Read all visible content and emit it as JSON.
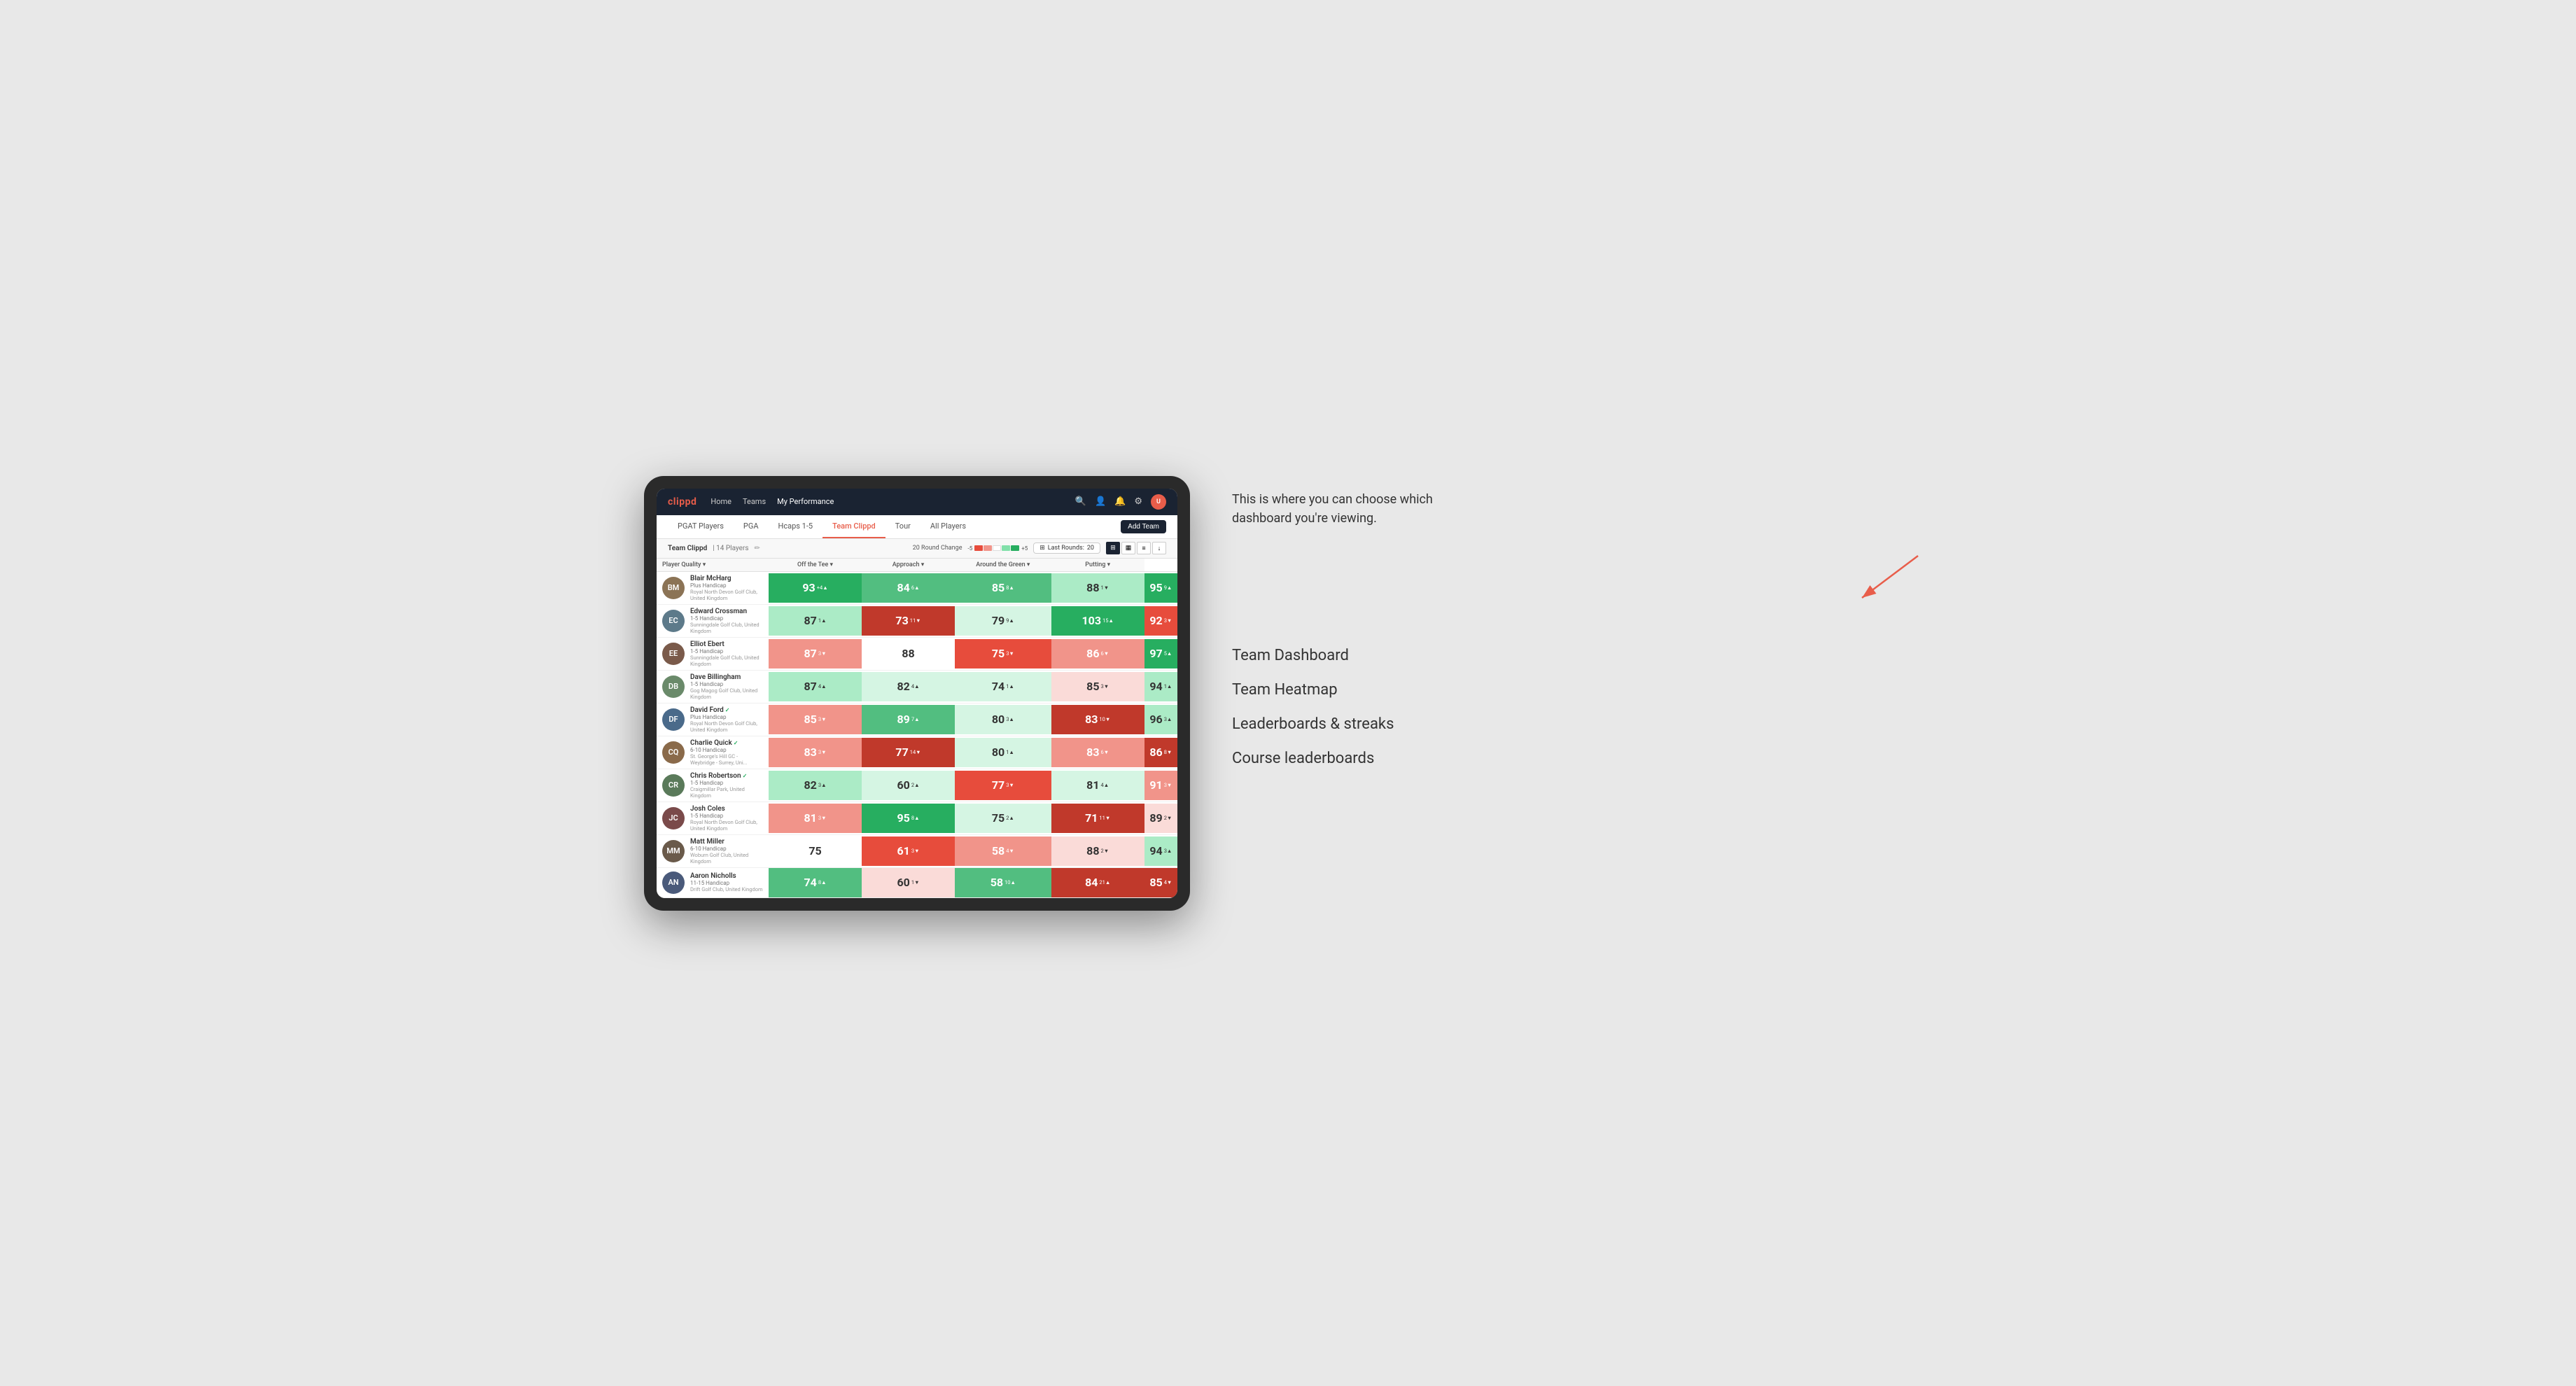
{
  "annotation": {
    "text": "This is where you can choose which dashboard you're viewing.",
    "menu_items": [
      "Team Dashboard",
      "Team Heatmap",
      "Leaderboards & streaks",
      "Course leaderboards"
    ]
  },
  "nav": {
    "logo": "clippd",
    "links": [
      "Home",
      "Teams",
      "My Performance"
    ],
    "active_link": "My Performance"
  },
  "sub_nav": {
    "links": [
      "PGAT Players",
      "PGA",
      "Hcaps 1-5",
      "Team Clippd",
      "Tour",
      "All Players"
    ],
    "active_link": "Team Clippd",
    "add_team_label": "Add Team"
  },
  "team_header": {
    "name": "Team Clippd",
    "separator": "|",
    "players_count": "14 Players",
    "round_change_label": "20 Round Change",
    "scale_minus": "-5",
    "scale_plus": "+5",
    "last_rounds_label": "Last Rounds:",
    "last_rounds_value": "20"
  },
  "table": {
    "columns": {
      "player": "Player Quality ▾",
      "off_tee": "Off the Tee ▾",
      "approach": "Approach ▾",
      "around_green": "Around the Green ▾",
      "putting": "Putting ▾"
    },
    "rows": [
      {
        "name": "Blair McHarg",
        "handicap": "Plus Handicap",
        "club": "Royal North Devon Golf Club, United Kingdom",
        "avatar_color": "#8B7355",
        "initials": "BM",
        "quality": {
          "value": 93,
          "change": "+4",
          "dir": "up",
          "bg": "bg-dark-green"
        },
        "off_tee": {
          "value": 84,
          "change": "6",
          "dir": "up",
          "bg": "bg-med-green"
        },
        "approach": {
          "value": 85,
          "change": "8",
          "dir": "up",
          "bg": "bg-med-green"
        },
        "around_green": {
          "value": 88,
          "change": "1",
          "dir": "down",
          "bg": "bg-light-green"
        },
        "putting": {
          "value": 95,
          "change": "9",
          "dir": "up",
          "bg": "bg-dark-green"
        }
      },
      {
        "name": "Edward Crossman",
        "handicap": "1-5 Handicap",
        "club": "Sunningdale Golf Club, United Kingdom",
        "avatar_color": "#5d7a8a",
        "initials": "EC",
        "quality": {
          "value": 87,
          "change": "1",
          "dir": "up",
          "bg": "bg-light-green"
        },
        "off_tee": {
          "value": 73,
          "change": "11",
          "dir": "down",
          "bg": "bg-dark-red"
        },
        "approach": {
          "value": 79,
          "change": "9",
          "dir": "up",
          "bg": "bg-pale-green"
        },
        "around_green": {
          "value": 103,
          "change": "15",
          "dir": "up",
          "bg": "bg-dark-green"
        },
        "putting": {
          "value": 92,
          "change": "3",
          "dir": "down",
          "bg": "bg-med-red"
        }
      },
      {
        "name": "Elliot Ebert",
        "handicap": "1-5 Handicap",
        "club": "Sunningdale Golf Club, United Kingdom",
        "avatar_color": "#7a5a4a",
        "initials": "EE",
        "quality": {
          "value": 87,
          "change": "3",
          "dir": "down",
          "bg": "bg-light-red"
        },
        "off_tee": {
          "value": 88,
          "change": "",
          "dir": "",
          "bg": "bg-white"
        },
        "approach": {
          "value": 75,
          "change": "3",
          "dir": "down",
          "bg": "bg-med-red"
        },
        "around_green": {
          "value": 86,
          "change": "6",
          "dir": "down",
          "bg": "bg-light-red"
        },
        "putting": {
          "value": 97,
          "change": "5",
          "dir": "up",
          "bg": "bg-dark-green"
        }
      },
      {
        "name": "Dave Billingham",
        "handicap": "1-5 Handicap",
        "club": "Gog Magog Golf Club, United Kingdom",
        "avatar_color": "#6a8a6a",
        "initials": "DB",
        "quality": {
          "value": 87,
          "change": "4",
          "dir": "up",
          "bg": "bg-light-green"
        },
        "off_tee": {
          "value": 82,
          "change": "4",
          "dir": "up",
          "bg": "bg-pale-green"
        },
        "approach": {
          "value": 74,
          "change": "1",
          "dir": "up",
          "bg": "bg-pale-green"
        },
        "around_green": {
          "value": 85,
          "change": "3",
          "dir": "down",
          "bg": "bg-pale-red"
        },
        "putting": {
          "value": 94,
          "change": "1",
          "dir": "up",
          "bg": "bg-light-green"
        }
      },
      {
        "name": "David Ford",
        "handicap": "Plus Handicap",
        "club": "Royal North Devon Golf Club, United Kingdom",
        "avatar_color": "#4a6a8a",
        "initials": "DF",
        "verified": true,
        "quality": {
          "value": 85,
          "change": "3",
          "dir": "down",
          "bg": "bg-light-red"
        },
        "off_tee": {
          "value": 89,
          "change": "7",
          "dir": "up",
          "bg": "bg-med-green"
        },
        "approach": {
          "value": 80,
          "change": "3",
          "dir": "up",
          "bg": "bg-pale-green"
        },
        "around_green": {
          "value": 83,
          "change": "10",
          "dir": "down",
          "bg": "bg-dark-red"
        },
        "putting": {
          "value": 96,
          "change": "3",
          "dir": "up",
          "bg": "bg-light-green"
        }
      },
      {
        "name": "Charlie Quick",
        "handicap": "6-10 Handicap",
        "club": "St. George's Hill GC - Weybridge - Surrey, Uni...",
        "avatar_color": "#8a6a4a",
        "initials": "CQ",
        "verified": true,
        "quality": {
          "value": 83,
          "change": "3",
          "dir": "down",
          "bg": "bg-light-red"
        },
        "off_tee": {
          "value": 77,
          "change": "14",
          "dir": "down",
          "bg": "bg-dark-red"
        },
        "approach": {
          "value": 80,
          "change": "1",
          "dir": "up",
          "bg": "bg-pale-green"
        },
        "around_green": {
          "value": 83,
          "change": "6",
          "dir": "down",
          "bg": "bg-light-red"
        },
        "putting": {
          "value": 86,
          "change": "8",
          "dir": "down",
          "bg": "bg-dark-red"
        }
      },
      {
        "name": "Chris Robertson",
        "handicap": "1-5 Handicap",
        "club": "Craigmillar Park, United Kingdom",
        "avatar_color": "#5a7a5a",
        "initials": "CR",
        "verified": true,
        "quality": {
          "value": 82,
          "change": "3",
          "dir": "up",
          "bg": "bg-light-green"
        },
        "off_tee": {
          "value": 60,
          "change": "2",
          "dir": "up",
          "bg": "bg-pale-green"
        },
        "approach": {
          "value": 77,
          "change": "3",
          "dir": "down",
          "bg": "bg-med-red"
        },
        "around_green": {
          "value": 81,
          "change": "4",
          "dir": "up",
          "bg": "bg-pale-green"
        },
        "putting": {
          "value": 91,
          "change": "3",
          "dir": "down",
          "bg": "bg-light-red"
        }
      },
      {
        "name": "Josh Coles",
        "handicap": "1-5 Handicap",
        "club": "Royal North Devon Golf Club, United Kingdom",
        "avatar_color": "#7a4a4a",
        "initials": "JC",
        "quality": {
          "value": 81,
          "change": "3",
          "dir": "down",
          "bg": "bg-light-red"
        },
        "off_tee": {
          "value": 95,
          "change": "8",
          "dir": "up",
          "bg": "bg-dark-green"
        },
        "approach": {
          "value": 75,
          "change": "2",
          "dir": "up",
          "bg": "bg-pale-green"
        },
        "around_green": {
          "value": 71,
          "change": "11",
          "dir": "down",
          "bg": "bg-dark-red"
        },
        "putting": {
          "value": 89,
          "change": "2",
          "dir": "down",
          "bg": "bg-pale-red"
        }
      },
      {
        "name": "Matt Miller",
        "handicap": "6-10 Handicap",
        "club": "Woburn Golf Club, United Kingdom",
        "avatar_color": "#6a5a4a",
        "initials": "MM",
        "quality": {
          "value": 75,
          "change": "",
          "dir": "",
          "bg": "bg-white"
        },
        "off_tee": {
          "value": 61,
          "change": "3",
          "dir": "down",
          "bg": "bg-med-red"
        },
        "approach": {
          "value": 58,
          "change": "4",
          "dir": "down",
          "bg": "bg-light-red"
        },
        "around_green": {
          "value": 88,
          "change": "2",
          "dir": "down",
          "bg": "bg-pale-red"
        },
        "putting": {
          "value": 94,
          "change": "3",
          "dir": "up",
          "bg": "bg-light-green"
        }
      },
      {
        "name": "Aaron Nicholls",
        "handicap": "11-15 Handicap",
        "club": "Drift Golf Club, United Kingdom",
        "avatar_color": "#4a5a7a",
        "initials": "AN",
        "quality": {
          "value": 74,
          "change": "8",
          "dir": "up",
          "bg": "bg-med-green"
        },
        "off_tee": {
          "value": 60,
          "change": "1",
          "dir": "down",
          "bg": "bg-pale-red"
        },
        "approach": {
          "value": 58,
          "change": "10",
          "dir": "up",
          "bg": "bg-med-green"
        },
        "around_green": {
          "value": 84,
          "change": "21",
          "dir": "up",
          "bg": "bg-dark-red"
        },
        "putting": {
          "value": 85,
          "change": "4",
          "dir": "down",
          "bg": "bg-dark-red"
        }
      }
    ]
  }
}
